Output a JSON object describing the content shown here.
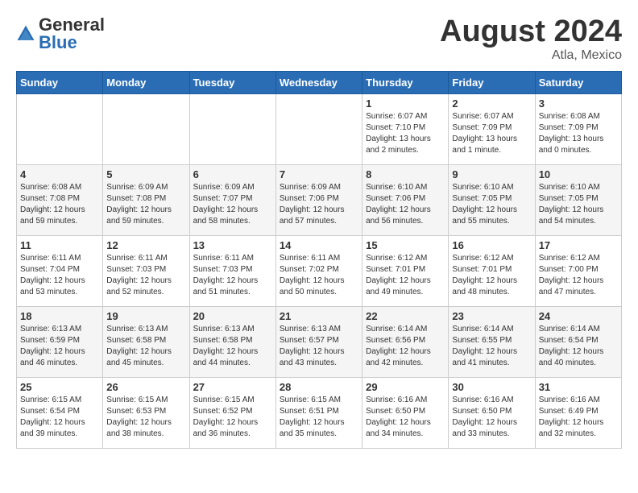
{
  "logo": {
    "general": "General",
    "blue": "Blue"
  },
  "title": "August 2024",
  "location": "Atla, Mexico",
  "days_of_week": [
    "Sunday",
    "Monday",
    "Tuesday",
    "Wednesday",
    "Thursday",
    "Friday",
    "Saturday"
  ],
  "weeks": [
    [
      {
        "day": "",
        "info": ""
      },
      {
        "day": "",
        "info": ""
      },
      {
        "day": "",
        "info": ""
      },
      {
        "day": "",
        "info": ""
      },
      {
        "day": "1",
        "info": "Sunrise: 6:07 AM\nSunset: 7:10 PM\nDaylight: 13 hours\nand 2 minutes."
      },
      {
        "day": "2",
        "info": "Sunrise: 6:07 AM\nSunset: 7:09 PM\nDaylight: 13 hours\nand 1 minute."
      },
      {
        "day": "3",
        "info": "Sunrise: 6:08 AM\nSunset: 7:09 PM\nDaylight: 13 hours\nand 0 minutes."
      }
    ],
    [
      {
        "day": "4",
        "info": "Sunrise: 6:08 AM\nSunset: 7:08 PM\nDaylight: 12 hours\nand 59 minutes."
      },
      {
        "day": "5",
        "info": "Sunrise: 6:09 AM\nSunset: 7:08 PM\nDaylight: 12 hours\nand 59 minutes."
      },
      {
        "day": "6",
        "info": "Sunrise: 6:09 AM\nSunset: 7:07 PM\nDaylight: 12 hours\nand 58 minutes."
      },
      {
        "day": "7",
        "info": "Sunrise: 6:09 AM\nSunset: 7:06 PM\nDaylight: 12 hours\nand 57 minutes."
      },
      {
        "day": "8",
        "info": "Sunrise: 6:10 AM\nSunset: 7:06 PM\nDaylight: 12 hours\nand 56 minutes."
      },
      {
        "day": "9",
        "info": "Sunrise: 6:10 AM\nSunset: 7:05 PM\nDaylight: 12 hours\nand 55 minutes."
      },
      {
        "day": "10",
        "info": "Sunrise: 6:10 AM\nSunset: 7:05 PM\nDaylight: 12 hours\nand 54 minutes."
      }
    ],
    [
      {
        "day": "11",
        "info": "Sunrise: 6:11 AM\nSunset: 7:04 PM\nDaylight: 12 hours\nand 53 minutes."
      },
      {
        "day": "12",
        "info": "Sunrise: 6:11 AM\nSunset: 7:03 PM\nDaylight: 12 hours\nand 52 minutes."
      },
      {
        "day": "13",
        "info": "Sunrise: 6:11 AM\nSunset: 7:03 PM\nDaylight: 12 hours\nand 51 minutes."
      },
      {
        "day": "14",
        "info": "Sunrise: 6:11 AM\nSunset: 7:02 PM\nDaylight: 12 hours\nand 50 minutes."
      },
      {
        "day": "15",
        "info": "Sunrise: 6:12 AM\nSunset: 7:01 PM\nDaylight: 12 hours\nand 49 minutes."
      },
      {
        "day": "16",
        "info": "Sunrise: 6:12 AM\nSunset: 7:01 PM\nDaylight: 12 hours\nand 48 minutes."
      },
      {
        "day": "17",
        "info": "Sunrise: 6:12 AM\nSunset: 7:00 PM\nDaylight: 12 hours\nand 47 minutes."
      }
    ],
    [
      {
        "day": "18",
        "info": "Sunrise: 6:13 AM\nSunset: 6:59 PM\nDaylight: 12 hours\nand 46 minutes."
      },
      {
        "day": "19",
        "info": "Sunrise: 6:13 AM\nSunset: 6:58 PM\nDaylight: 12 hours\nand 45 minutes."
      },
      {
        "day": "20",
        "info": "Sunrise: 6:13 AM\nSunset: 6:58 PM\nDaylight: 12 hours\nand 44 minutes."
      },
      {
        "day": "21",
        "info": "Sunrise: 6:13 AM\nSunset: 6:57 PM\nDaylight: 12 hours\nand 43 minutes."
      },
      {
        "day": "22",
        "info": "Sunrise: 6:14 AM\nSunset: 6:56 PM\nDaylight: 12 hours\nand 42 minutes."
      },
      {
        "day": "23",
        "info": "Sunrise: 6:14 AM\nSunset: 6:55 PM\nDaylight: 12 hours\nand 41 minutes."
      },
      {
        "day": "24",
        "info": "Sunrise: 6:14 AM\nSunset: 6:54 PM\nDaylight: 12 hours\nand 40 minutes."
      }
    ],
    [
      {
        "day": "25",
        "info": "Sunrise: 6:15 AM\nSunset: 6:54 PM\nDaylight: 12 hours\nand 39 minutes."
      },
      {
        "day": "26",
        "info": "Sunrise: 6:15 AM\nSunset: 6:53 PM\nDaylight: 12 hours\nand 38 minutes."
      },
      {
        "day": "27",
        "info": "Sunrise: 6:15 AM\nSunset: 6:52 PM\nDaylight: 12 hours\nand 36 minutes."
      },
      {
        "day": "28",
        "info": "Sunrise: 6:15 AM\nSunset: 6:51 PM\nDaylight: 12 hours\nand 35 minutes."
      },
      {
        "day": "29",
        "info": "Sunrise: 6:16 AM\nSunset: 6:50 PM\nDaylight: 12 hours\nand 34 minutes."
      },
      {
        "day": "30",
        "info": "Sunrise: 6:16 AM\nSunset: 6:50 PM\nDaylight: 12 hours\nand 33 minutes."
      },
      {
        "day": "31",
        "info": "Sunrise: 6:16 AM\nSunset: 6:49 PM\nDaylight: 12 hours\nand 32 minutes."
      }
    ]
  ]
}
